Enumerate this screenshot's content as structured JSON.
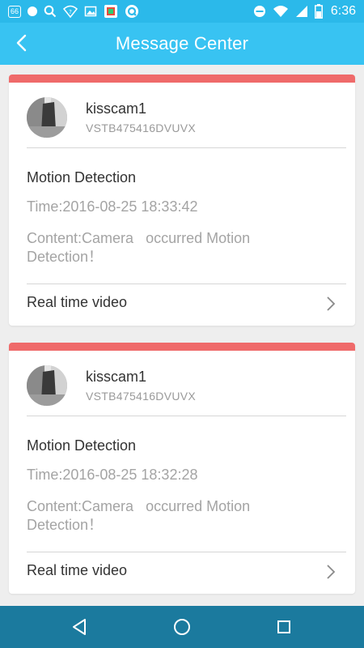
{
  "status_bar": {
    "left_badge": "66",
    "time": "6:36",
    "icons_left": [
      "notification-badge-icon",
      "dot-icon",
      "search-icon",
      "wifi-question-icon",
      "image-icon",
      "app-badge-icon",
      "q-app-icon"
    ],
    "icons_right": [
      "do-not-disturb-icon",
      "wifi-icon",
      "cell-signal-icon",
      "battery-icon"
    ]
  },
  "header": {
    "title": "Message Center",
    "back_icon": "chevron-left-icon"
  },
  "messages": [
    {
      "device_name": "kisscam1",
      "device_id": "VSTB475416DVUVX",
      "event": "Motion Detection",
      "time": "Time:2016-08-25 18:33:42",
      "content": "Content:Camera   occurred Motion Detection！",
      "action_label": "Real time video"
    },
    {
      "device_name": "kisscam1",
      "device_id": "VSTB475416DVUVX",
      "event": "Motion Detection",
      "time": "Time:2016-08-25 18:32:28",
      "content": "Content:Camera   occurred Motion Detection！",
      "action_label": "Real time video"
    }
  ],
  "nav_bar": {
    "icons": [
      "back-triangle-icon",
      "home-circle-icon",
      "recents-square-icon"
    ]
  },
  "colors": {
    "header_bg": "#38c3f2",
    "status_bg": "#2bb9ea",
    "card_accent": "#ef6a6a",
    "nav_bg": "#1b7a9e"
  }
}
